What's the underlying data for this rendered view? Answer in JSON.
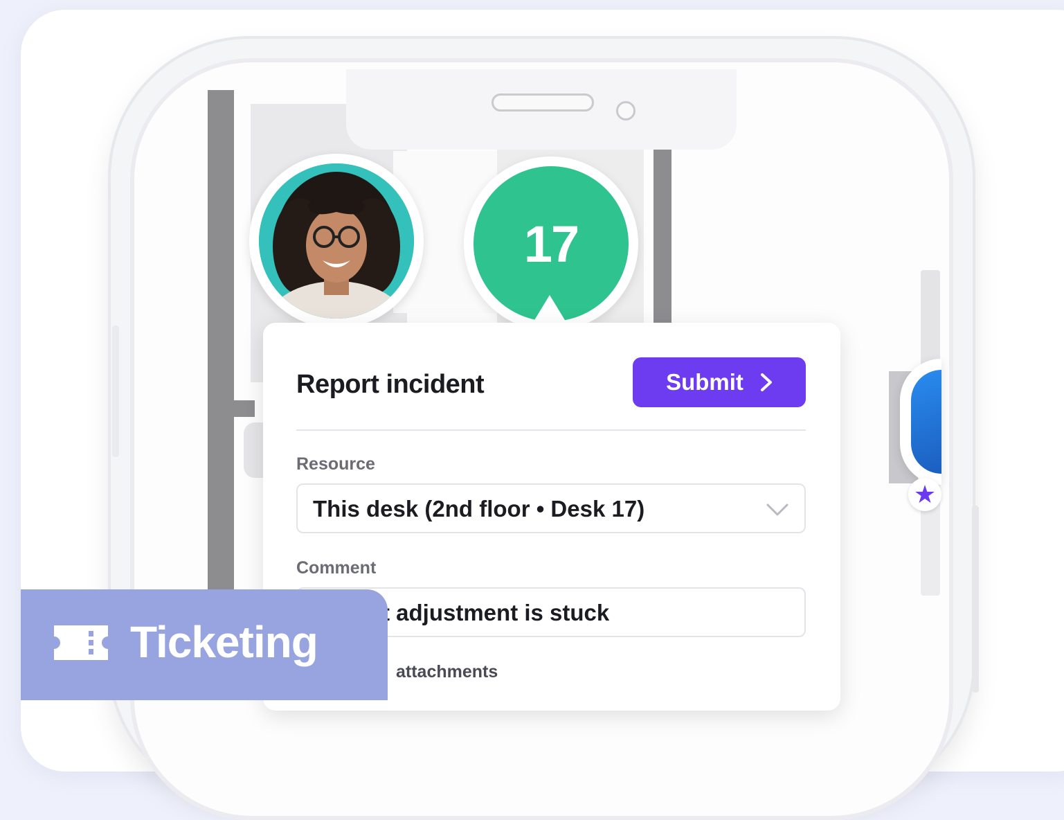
{
  "map": {
    "desk_number": "17"
  },
  "incident_panel": {
    "title": "Report incident",
    "submit_label": "Submit",
    "resource": {
      "label": "Resource",
      "value": "This desk (2nd floor • Desk 17)"
    },
    "comment": {
      "label": "Comment",
      "value": "t adjustment is stuck"
    },
    "attachments": {
      "label": "attachments"
    }
  },
  "badge": {
    "label": "Ticketing",
    "icon": "ticket-icon"
  },
  "colors": {
    "accent": "#6d3bf0",
    "desk_pin": "#2fc48f",
    "badge": "#97a4e0"
  }
}
